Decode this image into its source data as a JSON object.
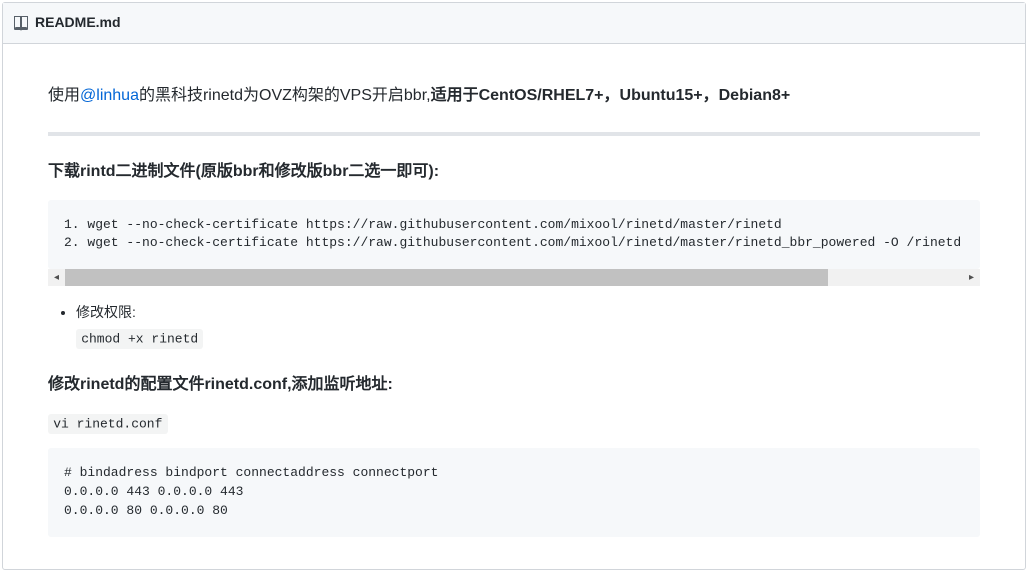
{
  "header": {
    "filename": "README.md"
  },
  "intro": {
    "prefix": "使用",
    "mention": "@linhua",
    "mid": "的黑科技rinetd为OVZ构架的VPS开启bbr,",
    "bold": "适用于CentOS/RHEL7+，Ubuntu15+，Debian8+"
  },
  "section1": {
    "heading": "下载rintd二进制文件(原版bbr和修改版bbr二选一即可):",
    "code": "1. wget --no-check-certificate https://raw.githubusercontent.com/mixool/rinetd/master/rinetd\n2. wget --no-check-certificate https://raw.githubusercontent.com/mixool/rinetd/master/rinetd_bbr_powered -O /rinetd"
  },
  "bullet": {
    "label": "修改权限:",
    "code": "chmod +x rinetd"
  },
  "section2": {
    "heading": "修改rinetd的配置文件rinetd.conf,添加监听地址:",
    "inline_code": "vi rinetd.conf",
    "block_code": "# bindadress bindport connectaddress connectport\n0.0.0.0 443 0.0.0.0 443\n0.0.0.0 80 0.0.0.0 80"
  }
}
